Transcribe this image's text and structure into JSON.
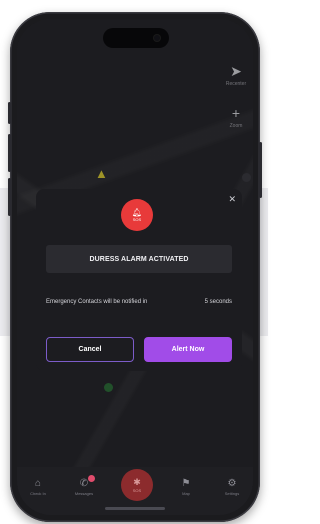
{
  "modal": {
    "badge_label": "SOS",
    "title": "DURESS ALARM ACTIVATED",
    "info_text": "Emergency Contacts will be notified in",
    "countdown": "5 seconds",
    "cancel_label": "Cancel",
    "alert_label": "Alert Now",
    "close_icon": "close-icon"
  },
  "map": {
    "controls": [
      {
        "icon": "navigation-icon",
        "glyph": "➤",
        "label": "Recenter"
      },
      {
        "icon": "plus-icon",
        "glyph": "+",
        "label": "Zoom"
      }
    ]
  },
  "tabs": [
    {
      "icon": "home-icon",
      "glyph": "⌂",
      "label": "Check In"
    },
    {
      "icon": "chat-icon",
      "glyph": "✆",
      "label": "Messages"
    },
    {
      "icon": "sos-icon",
      "glyph": "✱",
      "label": "SOS"
    },
    {
      "icon": "flag-icon",
      "glyph": "⚑",
      "label": "Map"
    },
    {
      "icon": "gear-icon",
      "glyph": "⚙",
      "label": "Settings"
    }
  ],
  "colors": {
    "alarm_red": "#e83a3a",
    "primary_purple": "#a14ce8",
    "cancel_border": "#7c5cc9",
    "background_dark": "#1c1c20"
  }
}
